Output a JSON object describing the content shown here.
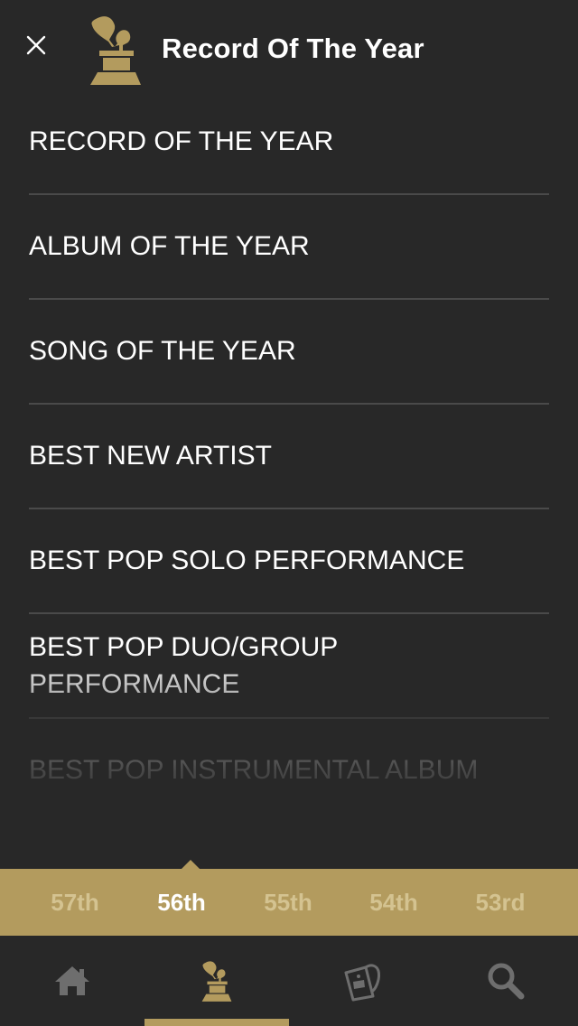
{
  "header": {
    "title": "Record Of The Year",
    "close_icon": "close-icon",
    "logo_icon": "gramophone-icon"
  },
  "categories": [
    {
      "label": "RECORD OF THE YEAR"
    },
    {
      "label": "ALBUM OF THE YEAR"
    },
    {
      "label": "SONG OF THE YEAR"
    },
    {
      "label": "BEST NEW ARTIST"
    },
    {
      "label": "BEST POP SOLO PERFORMANCE"
    },
    {
      "label": "BEST POP DUO/GROUP PERFORMANCE"
    },
    {
      "label": "BEST POP INSTRUMENTAL ALBUM"
    }
  ],
  "years": [
    {
      "label": "57th"
    },
    {
      "label": "56th",
      "active": true
    },
    {
      "label": "55th"
    },
    {
      "label": "54th"
    },
    {
      "label": "53rd"
    }
  ],
  "tabs": [
    {
      "name": "home",
      "icon": "home-icon"
    },
    {
      "name": "awards",
      "icon": "gramophone-icon",
      "active": true
    },
    {
      "name": "tickets",
      "icon": "ticket-icon"
    },
    {
      "name": "search",
      "icon": "search-icon"
    }
  ],
  "colors": {
    "background": "#282828",
    "accent_gold": "#b39b5e",
    "divider": "#4a4a4a",
    "inactive_icon": "#6e6e6e"
  }
}
